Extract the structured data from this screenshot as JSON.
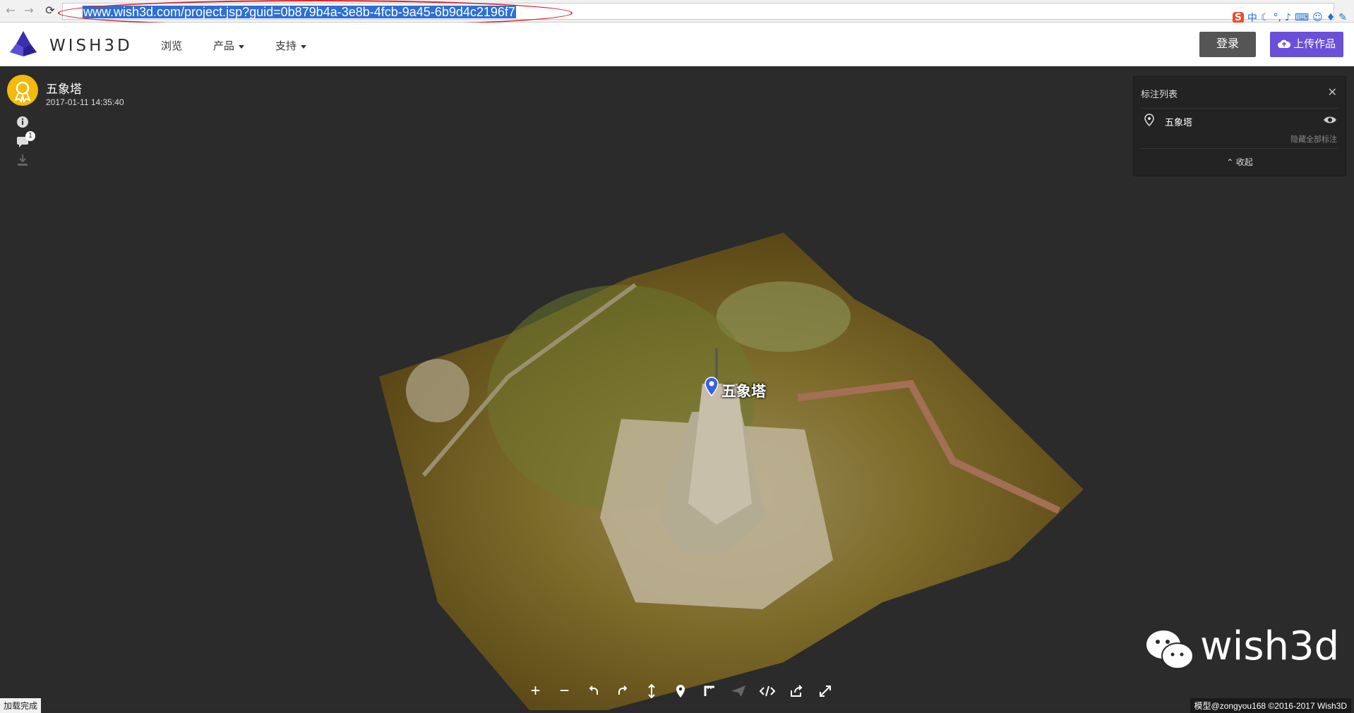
{
  "browser": {
    "url": "www.wish3d.com/project.jsp?guid=0b879b4a-3e8b-4fcb-9a45-6b9d4c2196f7",
    "ime_label": "中"
  },
  "header": {
    "brand": "WISH3D",
    "nav": [
      "浏览",
      "产品",
      "支持"
    ],
    "login_label": "登录",
    "upload_label": "上传作品"
  },
  "project": {
    "title": "五象塔",
    "date": "2017-01-11 14:35:40",
    "comment_count": "1"
  },
  "annotation_panel": {
    "title": "标注列表",
    "close_symbol": "✕",
    "item": "五象塔",
    "hide_all_label": "隐藏全部标注",
    "collapse_label": "收起",
    "collapse_symbol": "⌃"
  },
  "scene": {
    "marker_label": "五象塔"
  },
  "toolbar": {
    "plus": "+",
    "minus": "−"
  },
  "watermark": {
    "text": "wish3d"
  },
  "status": {
    "left": "加载完成",
    "right": "模型@zongyou168  ©2016-2017 Wish3D"
  }
}
